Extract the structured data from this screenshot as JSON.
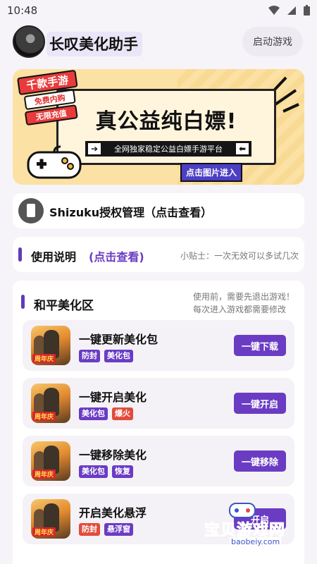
{
  "status_bar": {
    "time": "10:48",
    "icons": [
      "wifi-icon",
      "signal-icon",
      "battery-icon"
    ]
  },
  "header": {
    "title": "长叹美化助手",
    "launch_button": "启动游戏"
  },
  "banner": {
    "badge_lines": [
      "千款手游",
      "免费内购",
      "无限充值"
    ],
    "headline": "真公益纯白嫖!",
    "strip_text": "全网独家稳定公益白嫖手游平台",
    "cta": "点击图片进入"
  },
  "shizuku": {
    "label": "Shizuku授权管理（点击查看）"
  },
  "usage": {
    "label": "使用说明",
    "link": "(点击查看)",
    "tip": "小贴士：一次无效可以多试几次"
  },
  "section": {
    "title": "和平美化区",
    "note_lines": [
      "使用前，需要先退出游戏！",
      "每次进入游戏都需要修改"
    ],
    "items": [
      {
        "name": "一键更新美化包",
        "tags": [
          {
            "text": "防封",
            "color": "purple"
          },
          {
            "text": "美化包",
            "color": "purple"
          }
        ],
        "button": "一键下载",
        "thumb_caption": "周年庆"
      },
      {
        "name": "一键开启美化",
        "tags": [
          {
            "text": "美化包",
            "color": "purple"
          },
          {
            "text": "爆火",
            "color": "red"
          }
        ],
        "button": "一键开启",
        "thumb_caption": "周年庆"
      },
      {
        "name": "一键移除美化",
        "tags": [
          {
            "text": "美化包",
            "color": "purple"
          },
          {
            "text": "恢复",
            "color": "purple"
          }
        ],
        "button": "一键移除",
        "thumb_caption": "周年庆"
      },
      {
        "name": "开启美化悬浮",
        "tags": [
          {
            "text": "防封",
            "color": "red"
          },
          {
            "text": "悬浮窗",
            "color": "purple"
          }
        ],
        "button": "开启",
        "thumb_caption": "周年庆"
      }
    ]
  },
  "watermark": {
    "text": "宝贝游戏网",
    "url": "baobeiy.com"
  },
  "colors": {
    "accent": "#6a3cc4",
    "tag_red": "#e24b3c",
    "banner_bg": "#fbe1a3"
  }
}
